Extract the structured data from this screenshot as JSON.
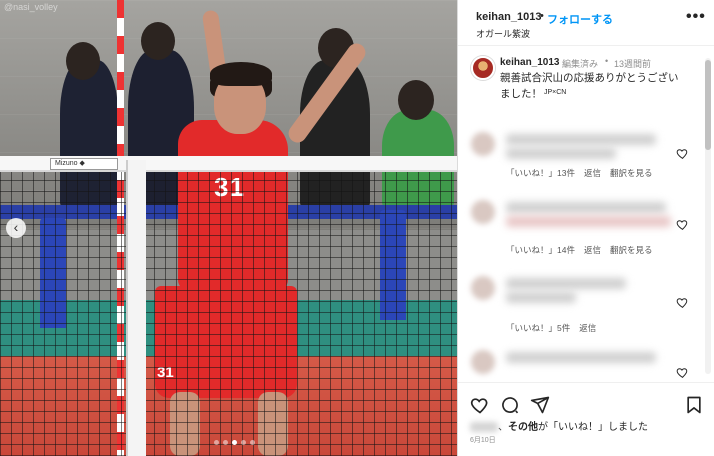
{
  "photo": {
    "watermark": "@nasi_volley",
    "net_tag": "Mizuno ◆",
    "jersey_number": "31",
    "shorts_number": "31",
    "nav_prev": "‹",
    "slide_count": 5,
    "active_slide": 3
  },
  "header": {
    "username": "keihan_1013",
    "separator": "•",
    "follow_label": "フォローする",
    "location": "オガール紫波",
    "more_label": "•••"
  },
  "caption": {
    "username": "keihan_1013",
    "edited": "編集済み",
    "dot": "•",
    "time": "13週間前",
    "text_line1": "親善試合沢山の応援ありがとうござい",
    "text_line2": "ました！",
    "tag": "JP×CN"
  },
  "comments": [
    {
      "likes": "「いいね！」13件",
      "reply": "返信",
      "translate": "翻訳を見る"
    },
    {
      "likes": "「いいね！」14件",
      "reply": "返信",
      "translate": "翻訳を見る"
    },
    {
      "likes": "「いいね！」5件",
      "reply": "返信",
      "translate": ""
    },
    {
      "likes": "",
      "reply": "",
      "translate": ""
    }
  ],
  "likes_line": {
    "suffix": "、",
    "others": "その他",
    "rest": "が「いいね！」しました"
  },
  "date": "6月10日",
  "colors": {
    "link_blue": "#0095f6",
    "jersey_red": "#e22a2a",
    "court_teal": "#2f8f80"
  }
}
